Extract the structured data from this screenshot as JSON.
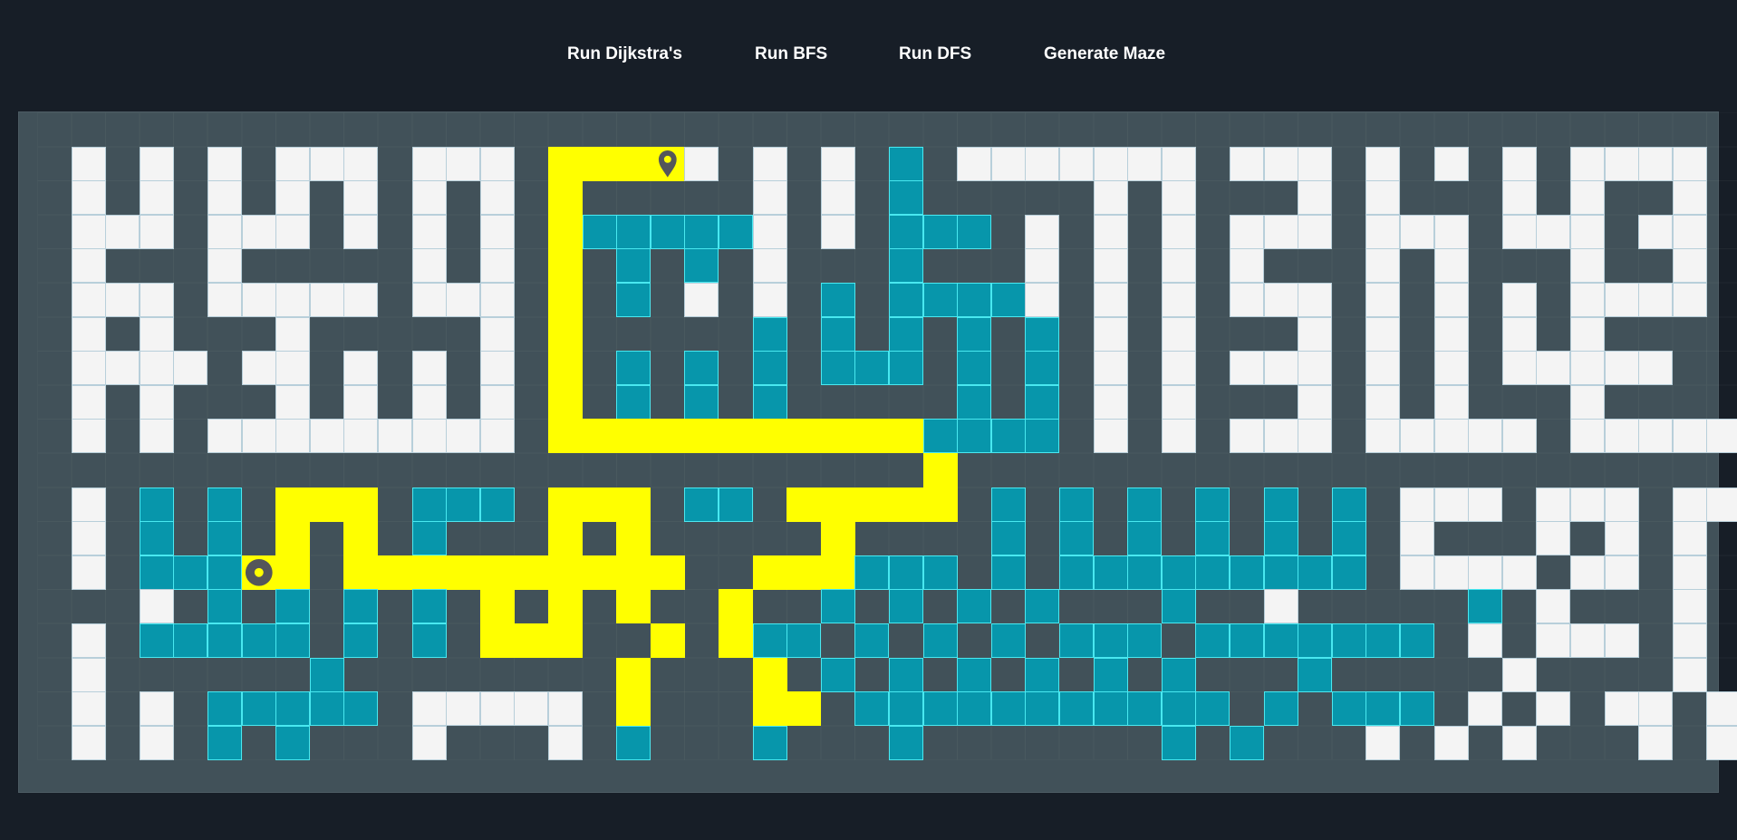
{
  "nav": {
    "dijkstra_label": "Run Dijkstra's",
    "bfs_label": "Run BFS",
    "dfs_label": "Run DFS",
    "generate_label": "Generate Maze"
  },
  "colors": {
    "background": "#171e27",
    "board": "#415159",
    "wall": "#f4f4f4",
    "visited": "#0796ab",
    "path": "#ffff00",
    "marker": "#54565a"
  },
  "grid": {
    "cols": 50,
    "rows": 19,
    "legend": {
      "#": "wall",
      "v": "visited",
      "p": "path",
      ".": "empty"
    },
    "cells": [
      "..................................................",
      ".#.#.#.###.###.pppp#.#.#.v.#######.###.#.#.#.####.",
      ".#.#.#.#.#.#.#.p.....#.#.v.....#.#...#.#...#.#..#.",
      ".###.###.#.#.#.pvvvvv#.#.vvv.#.#.#.###.###.###.##.",
      ".#...#.....#.#.p.v.v.#...v...#.#.#.#...#.#...#..#.",
      ".###.#####.###.p.v.#.#.v.vvvv#.#.#.###.#.#.#.####.",
      ".#.#...#.....#.p.....v.v.v.v.v.#.#...#.#.#.#.#....",
      ".####.##.#.#.#.p.v.v.v.vvv.v.v.#.#.###.#.#.#####..",
      ".#.#...#.#.#.#.p.v.v.v.....v.v.#.#...#.#.#...#....",
      ".#.#.#########.pppppppppppvvvv.#.#.###.#####.#####",
      "..........................p.......................",
      ".#.v.v.ppp.vvv.ppp.vv.ppppp.v.v.v.v.v.v.###.###.##",
      ".#.v.v.p.p.v...p.p.....p....v.v.v.v.v.v.#...#.#.#.",
      ".#.vvvpp.pppppppppp..pppvvv.v.vvvvvvvvv.####.##.#.",
      "...#.v.v.v.v.p.p.p..p..v.v.v.v...v..#.....v.#...#.",
      ".#.vvvvv.v.v.ppp..p.pvv.v.v.v.vvv.vvvvvvv.#.###.#.",
      ".#......v........p...p.v.v.v.v.v.v...v.....#....#.",
      ".#.#.vvvvv.#####.p...pp.vvvvvvvvvvv.v.vvv.#.#.##.#",
      ".#.#.v.v...#...#.v...v...v.......v.v...#.#.#...#.#"
    ],
    "start": {
      "row": 1,
      "col": 18
    },
    "target": {
      "row": 13,
      "col": 6
    }
  }
}
